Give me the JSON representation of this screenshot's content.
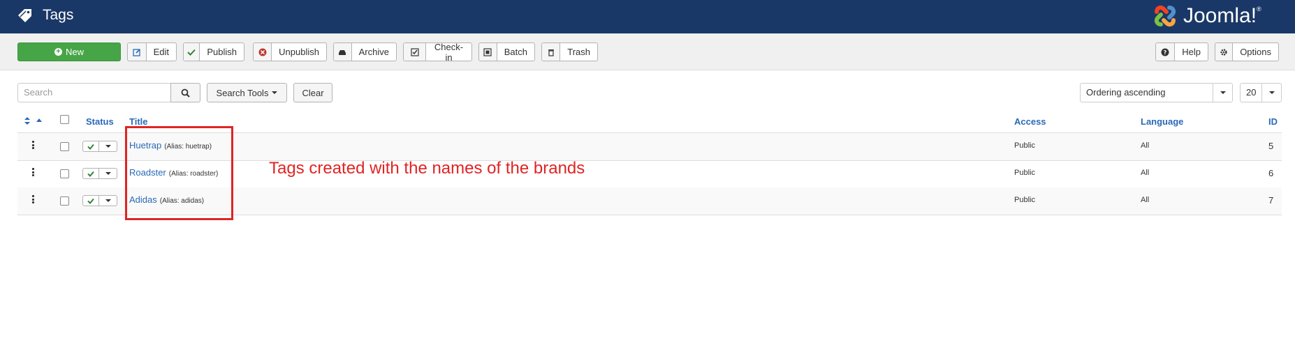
{
  "header": {
    "title": "Tags",
    "logo_text": "Joomla!",
    "logo_reg": "®"
  },
  "toolbar": {
    "new_label": "New",
    "edit_label": "Edit",
    "publish_label": "Publish",
    "unpublish_label": "Unpublish",
    "archive_label": "Archive",
    "checkin_label": "Check-in",
    "batch_label": "Batch",
    "trash_label": "Trash",
    "help_label": "Help",
    "options_label": "Options"
  },
  "filters": {
    "search_placeholder": "Search",
    "search_tools_label": "Search Tools",
    "clear_label": "Clear",
    "ordering_value": "Ordering ascending",
    "limit_value": "20"
  },
  "table": {
    "headers": {
      "status": "Status",
      "title": "Title",
      "access": "Access",
      "language": "Language",
      "id": "ID"
    },
    "rows": [
      {
        "title": "Huetrap",
        "alias": "(Alias: huetrap)",
        "access": "Public",
        "language": "All",
        "id": "5"
      },
      {
        "title": "Roadster",
        "alias": "(Alias: roadster)",
        "access": "Public",
        "language": "All",
        "id": "6"
      },
      {
        "title": "Adidas",
        "alias": "(Alias: adidas)",
        "access": "Public",
        "language": "All",
        "id": "7"
      }
    ]
  },
  "annotation": {
    "text": "Tags created with the names of the brands",
    "color": "#e02424"
  },
  "colors": {
    "header_bg": "#1a3867",
    "link": "#2a69b8",
    "new_button": "#46a546",
    "published_check": "#378137"
  }
}
